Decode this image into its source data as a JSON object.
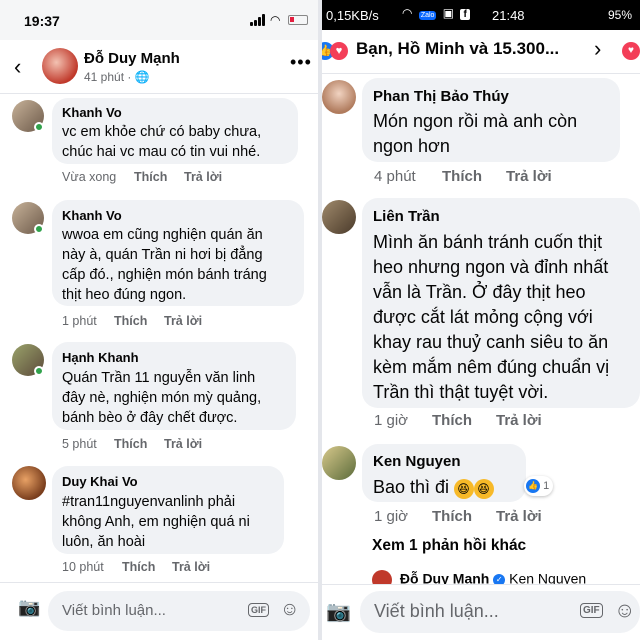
{
  "left": {
    "status": {
      "time": "19:37"
    },
    "header": {
      "name": "Đỗ Duy Mạnh",
      "meta": "41 phút · 🌐"
    },
    "comments": [
      {
        "author": "Khanh Vo",
        "text": "vc em khỏe chứ có baby chưa,\nchúc hai vc mau có tin vui nhé.",
        "time": "Vừa xong",
        "like": "Thích",
        "reply": "Trả lời"
      },
      {
        "author": "Khanh Vo",
        "text": "wwoa em cũng nghiện quán ăn\nnày à, quán Trần ni hơi bị đẳng\ncấp đó., nghiện món bánh tráng\nthịt heo đúng ngon.",
        "time": "1 phút",
        "like": "Thích",
        "reply": "Trả lời"
      },
      {
        "author": "Hạnh Khanh",
        "text": "Quán Trần 11 nguyễn văn linh\nđây nè, nghiện món mỳ quảng,\nbánh bèo ở đây chết được.",
        "time": "5 phút",
        "like": "Thích",
        "reply": "Trả lời"
      },
      {
        "author": "Duy Khai Vo",
        "text": "#tran11nguyenvanlinh phải\nkhông Anh, em nghiện quá ni\nluôn, ăn hoài",
        "time": "10 phút",
        "like": "Thích",
        "reply": "Trả lời"
      }
    ],
    "composer": {
      "placeholder": "Viết bình luận...",
      "gif": "GIF"
    }
  },
  "right": {
    "status": {
      "speed": "0,15KB/s",
      "time": "21:48",
      "battery": "95%",
      "zalo": "Zalo"
    },
    "header": {
      "title": "Bạn, Hồ Minh và 15.300..."
    },
    "comments": [
      {
        "author": "Phan Thị Bảo Thúy",
        "text": "Món ngon rồi mà anh còn\nngon hơn",
        "time": "4 phút",
        "like": "Thích",
        "reply": "Trả lời"
      },
      {
        "author": "Liên Trần",
        "text": "Mình ăn bánh tránh cuốn thịt\nheo nhưng ngon và đỉnh nhất\nvẫn là Trần. Ở đây thịt heo\nđược cắt lát mỏng cộng với\nkhay rau thuỷ canh siêu to ăn\nkèm mắm nêm đúng chuẩn vị\nTrần thì thật tuyệt vời.",
        "time": "1 giờ",
        "like": "Thích",
        "reply": "Trả lời"
      },
      {
        "author": "Ken Nguyen",
        "text": "Bao thì đi",
        "time": "1 giờ",
        "like": "Thích",
        "reply": "Trả lời",
        "reaction_count": "1"
      }
    ],
    "more_replies": "Xem 1 phản hồi khác",
    "reply_preview": {
      "name": "Đỗ Duy Mạnh",
      "tag": "Ken Nguyen"
    },
    "composer": {
      "placeholder": "Viết bình luận...",
      "gif": "GIF"
    }
  }
}
